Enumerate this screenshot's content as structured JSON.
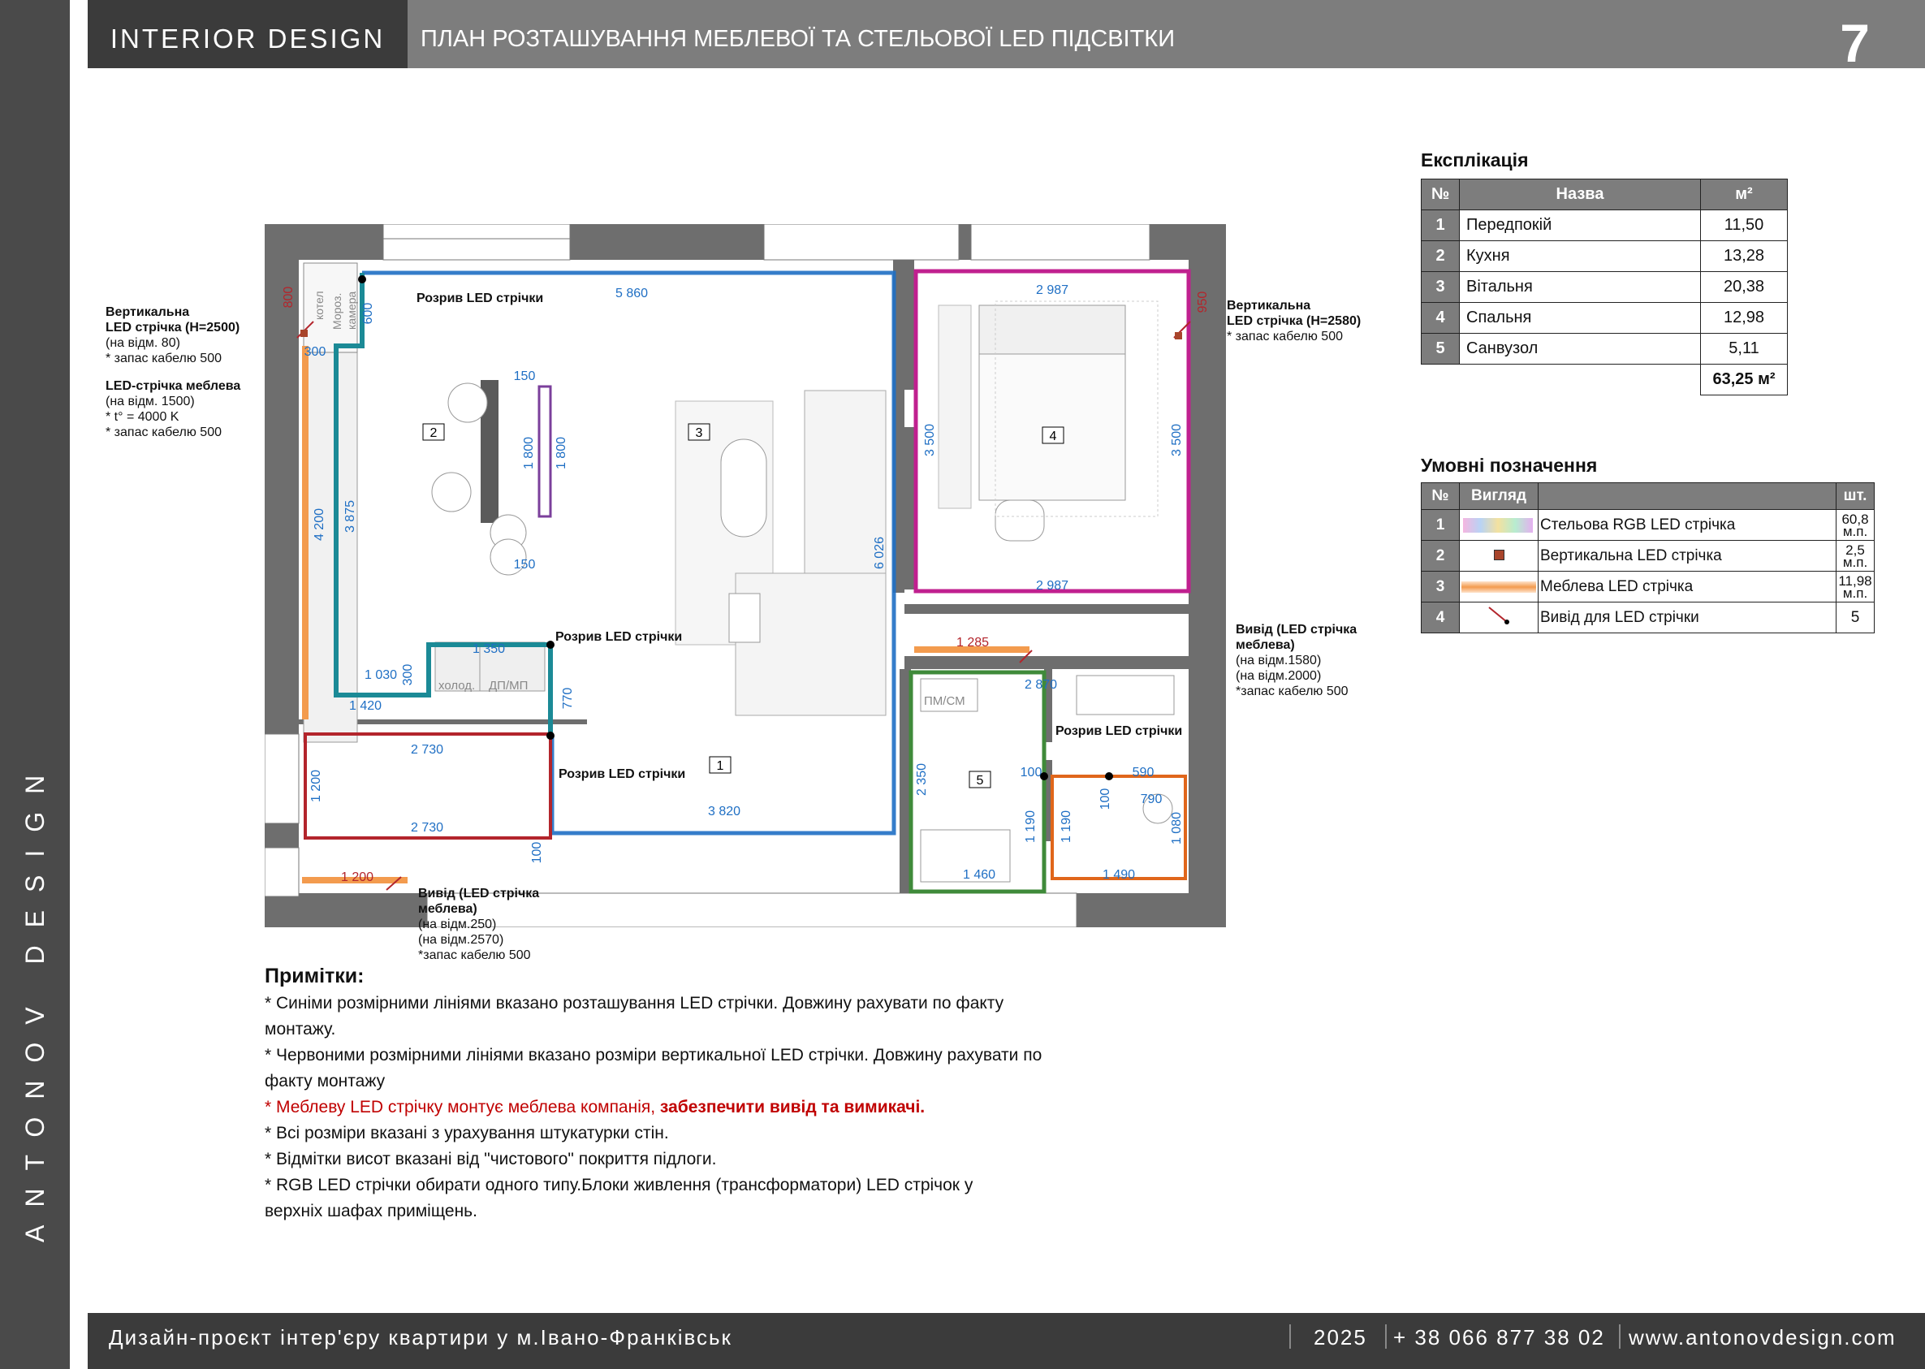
{
  "sidebar": {
    "brand": "ANTONOV DESIGN"
  },
  "header": {
    "left": "INTERIOR  DESIGN",
    "title": "ПЛАН РОЗТАШУВАННЯ МЕБЛЕВОЇ ТА СТЕЛЬОВОЇ LED ПІДСВІТКИ",
    "page": "7"
  },
  "plan": {
    "rooms": [
      {
        "id": "2"
      },
      {
        "id": "3"
      },
      {
        "id": "4"
      },
      {
        "id": "1"
      },
      {
        "id": "5"
      }
    ],
    "furniture": {
      "kotel": "котел",
      "moroz": "Мороз.",
      "kamera": "камера",
      "kholod": "холод.",
      "dpmp": "ДП/МП",
      "pmsm": "ПМ/СМ"
    },
    "dimensions": {
      "d5860": "5 860",
      "d2987a": "2 987",
      "d2987b": "2 987",
      "d800": "800",
      "d950": "950",
      "d600": "600",
      "d300a": "300",
      "d150a": "150",
      "d150b": "150",
      "d1800a": "1 800",
      "d1800b": "1 800",
      "d3500a": "3 500",
      "d3500b": "3 500",
      "d4200": "4 200",
      "d3875": "3 875",
      "d6026": "6 026",
      "d1350": "1 350",
      "d1030": "1 030",
      "d300b": "300",
      "d1420": "1 420",
      "d770": "770",
      "d1285": "1 285",
      "d2730a": "2 730",
      "d2730b": "2 730",
      "d1200a": "1 200",
      "d3820": "3 820",
      "d100a": "100",
      "d1200b": "1 200",
      "d2870": "2 870",
      "d2350": "2 350",
      "d100b": "100",
      "d590": "590",
      "d100c": "100",
      "d790": "790",
      "d1190a": "1 190",
      "d1190b": "1 190",
      "d1080": "1 080",
      "d1460": "1 460",
      "d1490": "1 490"
    },
    "labels": {
      "vert_left_t1": "Вертикальна",
      "vert_left_t2": "LED стрічка (H=2500)",
      "vert_left_t3": "(на відм. 80)",
      "vert_left_t4": "* запас кабелю 500",
      "furn_left_t1": "LED-стрічка меблева",
      "furn_left_t2": "(на відм. 1500)",
      "furn_left_t3": "* t° = 4000 K",
      "furn_left_t4": "* запас кабелю 500",
      "vert_right_t1": "Вертикальна",
      "vert_right_t2": "LED стрічка (H=2580)",
      "vert_right_t3": "* запас кабелю 500",
      "break1": "Розрив LED стрічки",
      "break2": "Розрив LED стрічки",
      "break3": "Розрив LED стрічки",
      "break4": "Розрив LED стрічки",
      "out_right_t1": "Вивід (LED стрічка",
      "out_right_t2": "меблева)",
      "out_right_t3": "(на відм.1580)",
      "out_right_t4": "(на відм.2000)",
      "out_right_t5": "*запас кабелю 500",
      "out_bottom_t1": "Вивід (LED стрічка",
      "out_bottom_t2": "меблева)",
      "out_bottom_t3": "(на відм.250)",
      "out_bottom_t4": "(на відм.2570)",
      "out_bottom_t5": "*запас кабелю 500"
    }
  },
  "explication": {
    "title": "Експлікація",
    "headers": [
      "№",
      "Назва",
      "м²"
    ],
    "rows": [
      {
        "n": "1",
        "name": "Передпокій",
        "area": "11,50"
      },
      {
        "n": "2",
        "name": "Кухня",
        "area": "13,28"
      },
      {
        "n": "3",
        "name": "Вітальня",
        "area": "20,38"
      },
      {
        "n": "4",
        "name": "Спальня",
        "area": "12,98"
      },
      {
        "n": "5",
        "name": "Санвузол",
        "area": "5,11"
      }
    ],
    "total": "63,25 м²"
  },
  "legend": {
    "title": "Умовні позначення",
    "headers": [
      "№",
      "Вигляд",
      "",
      "шт."
    ],
    "rows": [
      {
        "n": "1",
        "name": "Стельова RGB LED стрічка",
        "qty1": "60,8",
        "qty2": "м.п."
      },
      {
        "n": "2",
        "name": "Вертикальна LED стрічка",
        "qty1": "2,5",
        "qty2": "м.п."
      },
      {
        "n": "3",
        "name": "Меблева LED стрічка",
        "qty1": "11,98",
        "qty2": "м.п."
      },
      {
        "n": "4",
        "name": "Вивід для LED стрічки",
        "qty1": "5",
        "qty2": ""
      }
    ]
  },
  "notes": {
    "title": "Примітки:",
    "l1": "* Синіми розмірними лініями вказано розташування LED стрічки. Довжину рахувати по факту",
    "l2": "монтажу.",
    "l3": "* Червоними розмірними лініями вказано розміри вертикальної LED стрічки. Довжину рахувати по",
    "l4": "факту монтажу",
    "l5a": "* Меблеву LED стрічку монтує меблева компанія, ",
    "l5b": "забезпечити вивід та вимикачі.",
    "l6": "* Всі розміри вказані з урахування штукатурки стін.",
    "l7": "* Відмітки висот вказані від \"чистового\" покриття підлоги.",
    "l8": "* RGB LED стрічки обирати одного типу.Блоки живлення (трансформатори) LED стрічок у",
    "l9": "верхніх шафах приміщень."
  },
  "footer": {
    "project": "Дизайн-проєкт інтер'єру квартири у м.Івано-Франківськ",
    "year": "2025",
    "phone": "+ 38 066 877 38 02",
    "site": "www.antonovdesign.com"
  },
  "colors": {
    "dark": "#3b3b3b",
    "header": "#7d7d7d",
    "blue": "#1f6fc4",
    "teal": "#1b8a96",
    "orange": "#f39b4e",
    "magenta": "#c0208f",
    "red": "#b3252c",
    "green": "#3f8a3a"
  }
}
